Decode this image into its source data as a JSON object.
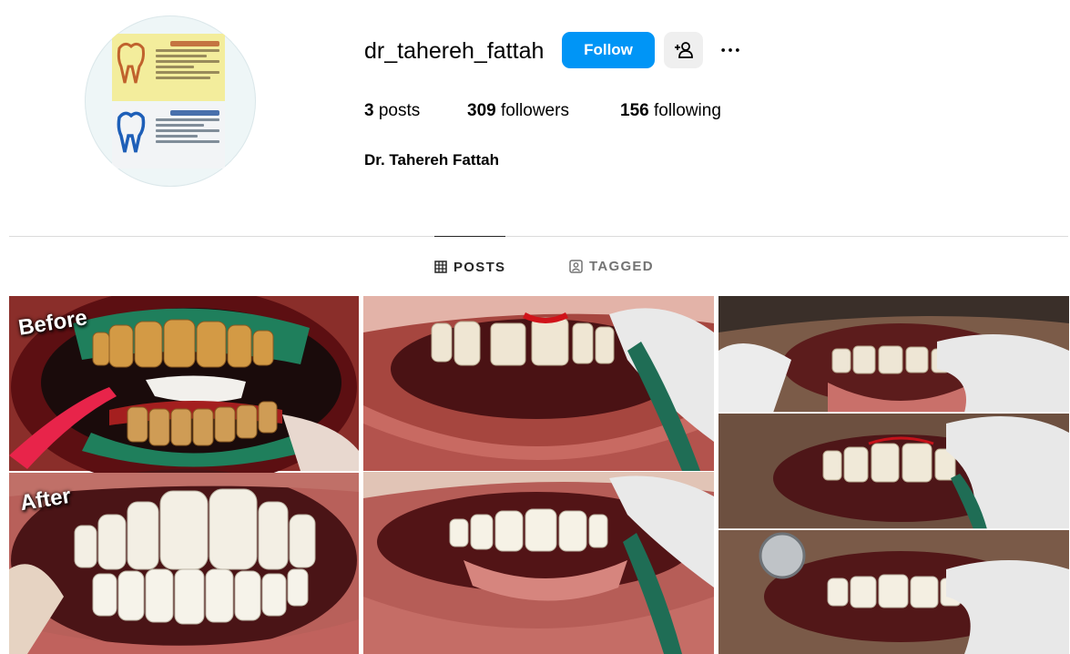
{
  "profile": {
    "username": "dr_tahereh_fattah",
    "full_name": "Dr. Tahereh Fattah",
    "avatar_icon": "business-card-avatar"
  },
  "actions": {
    "follow_label": "Follow",
    "suggest_icon": "person-add-icon",
    "more_icon": "more-horizontal-icon",
    "accent_color": "#0095f6"
  },
  "stats": {
    "posts_count": "3",
    "posts_label": "posts",
    "followers_count": "309",
    "followers_label": "followers",
    "following_count": "156",
    "following_label": "following"
  },
  "tabs": [
    {
      "label": "POSTS",
      "icon": "grid-icon",
      "active": true
    },
    {
      "label": "TAGGED",
      "icon": "tagged-icon",
      "active": false
    }
  ],
  "posts": [
    {
      "type": "before-after-photo",
      "overlay_before": "Before",
      "overlay_after": "After"
    },
    {
      "type": "two-panel-dental-photo"
    },
    {
      "type": "three-panel-dental-photo"
    }
  ]
}
